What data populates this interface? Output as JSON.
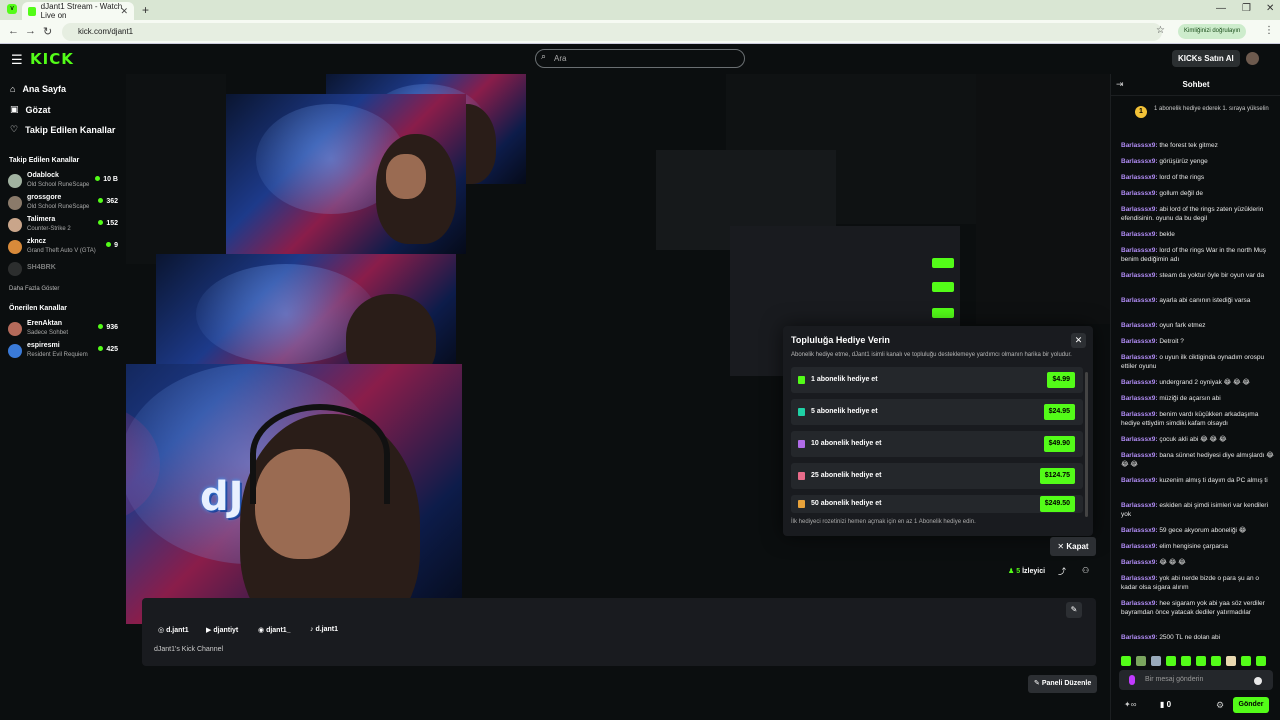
{
  "browser": {
    "tab_title": "dJant1 Stream - Watch Live on",
    "url": "kick.com/djant1",
    "auth_label": "Kimliğinizi doğrulayın"
  },
  "header": {
    "logo": "KICK",
    "search_placeholder": "Ara",
    "buy_label": "KICKs Satın Al"
  },
  "sidebar": {
    "nav": [
      {
        "label": "Ana Sayfa",
        "icon": "home-icon"
      },
      {
        "label": "Gözat",
        "icon": "browse-icon"
      },
      {
        "label": "Takip Edilen Kanallar",
        "icon": "heart-icon"
      }
    ],
    "followed_title": "Takip Edilen Kanallar",
    "followed": [
      {
        "name": "Odablock",
        "game": "Old School RuneScape",
        "viewers": "10 B",
        "color": "#a1b2a0"
      },
      {
        "name": "grossgore",
        "game": "Old School RuneScape",
        "viewers": "362",
        "color": "#8a7a6a"
      },
      {
        "name": "Talimera",
        "game": "Counter-Strike 2",
        "viewers": "152",
        "color": "#c9a58a"
      },
      {
        "name": "zkncz",
        "game": "Grand Theft Auto V (GTA)",
        "viewers": "9",
        "color": "#d88a3a"
      },
      {
        "name": "SH4BRK",
        "game": "",
        "viewers": "",
        "color": "#555555"
      }
    ],
    "show_more": "Daha Fazla Göster",
    "suggested_title": "Önerilen Kanallar",
    "suggested": [
      {
        "name": "ErenAktan",
        "game": "Sadece Sohbet",
        "viewers": "936",
        "color": "#b46a5a"
      },
      {
        "name": "espiresmi",
        "game": "Resident Evil Requiem",
        "viewers": "425",
        "color": "#3a7ad8"
      }
    ]
  },
  "video": {
    "brand_text": "dJant"
  },
  "modal": {
    "title": "Topluluğa Hediye Verin",
    "description": "Abonelik hediye etme, dJant1 isimli kanalı ve topluluğu desteklemeye yardımcı olmanın harika bir yoludur.",
    "rows": [
      {
        "label": "1 abonelik hediye et",
        "price": "$4.99",
        "color": "#53fc18"
      },
      {
        "label": "5 abonelik hediye et",
        "price": "$24.95",
        "color": "#1fd1a5"
      },
      {
        "label": "10 abonelik hediye et",
        "price": "$49.90",
        "color": "#b06be8"
      },
      {
        "label": "25 abonelik hediye et",
        "price": "$124.75",
        "color": "#e86b8a"
      },
      {
        "label": "50 abonelik hediye et",
        "price": "$249.50",
        "color": "#e8a23a"
      }
    ],
    "footer": "İlk hediyeci rozetinizi hemen açmak için en az 1 Abonelik hediye edin.",
    "close_label": "Kapat"
  },
  "stream_info": {
    "viewers_count": "5",
    "viewers_label": "İzleyici",
    "socials": [
      {
        "icon": "instagram-icon",
        "label": "d.jant1"
      },
      {
        "icon": "youtube-icon",
        "label": "djantiyt"
      },
      {
        "icon": "discord-icon",
        "label": "djant1_"
      },
      {
        "icon": "tiktok-icon",
        "label": "d.jant1"
      }
    ],
    "channel_desc": "dJant1's Kick Channel",
    "edit_panel": "Paneli Düzenle"
  },
  "chat": {
    "title": "Sohbet",
    "pinned": "1 abonelik hediye ederek 1. sıraya yükselin",
    "messages": [
      {
        "user": "Barlasssx9:",
        "text": "the forest tek gitmez"
      },
      {
        "user": "Barlasssx9:",
        "text": "görüşürüz yenge"
      },
      {
        "user": "Barlasssx9:",
        "text": "lord of the rings"
      },
      {
        "user": "Barlasssx9:",
        "text": "gollum değil de"
      },
      {
        "user": "Barlasssx9:",
        "text": "abi lord of the rings zaten yüzüklerin efendisinin. oyunu da bu degil"
      },
      {
        "user": "Barlasssx9:",
        "text": "bekle"
      },
      {
        "user": "Barlasssx9:",
        "text": "lord of the rings War in the north Muş benim dediğimin adı"
      },
      {
        "user": "Barlasssx9:",
        "text": "steam da yoktur öyle bir oyun var da"
      },
      {
        "user": "Barlasssx9:",
        "text": "ayarla abi canının istediği varsa"
      },
      {
        "user": "Barlasssx9:",
        "text": "oyun fark etmez"
      },
      {
        "user": "Barlasssx9:",
        "text": "Detroit ?"
      },
      {
        "user": "Barlasssx9:",
        "text": "o uyun ilk ciktiginda oynadım orospu ettiler oyunu"
      },
      {
        "user": "Barlasssx9:",
        "text": "undergrand 2 oyniyak 😂 😂 😂"
      },
      {
        "user": "Barlasssx9:",
        "text": "müziği de açarsın abi"
      },
      {
        "user": "Barlasssx9:",
        "text": "benim vardı küçükken arkadaşıma hediye ettiydim simdiki kafam olsaydı"
      },
      {
        "user": "Barlasssx9:",
        "text": "çocuk akli abi 😂 😂 😂"
      },
      {
        "user": "Barlasssx9:",
        "text": "bana sünnet hediyesi diye almışlardı 😂 😂 😂"
      },
      {
        "user": "Barlasssx9:",
        "text": "kuzenim almış ti dayım da PC almış ti"
      },
      {
        "user": "Barlasssx9:",
        "text": "eskiden abi şimdi isimleri var kendileri yok"
      },
      {
        "user": "Barlasssx9:",
        "text": "59 gece akyorum aboneliği 😂"
      },
      {
        "user": "Barlasssx9:",
        "text": "elim hengisine çarparsa"
      },
      {
        "user": "Barlasssx9:",
        "text": "😂 😂 😂"
      },
      {
        "user": "Barlasssx9:",
        "text": "yok abi nerde bizde o para şu an o kadar olsa sigara alırım"
      },
      {
        "user": "Barlasssx9:",
        "text": "hee sigaram yok abi yaa söz verdiler bayramdan önce yatacak dediler yatırmadılar"
      },
      {
        "user": "Barlasssx9:",
        "text": "2500 TL ne dolan abi"
      }
    ],
    "input_placeholder": "Bir mesaj gönderin",
    "points": "0",
    "send_label": "Gönder"
  }
}
